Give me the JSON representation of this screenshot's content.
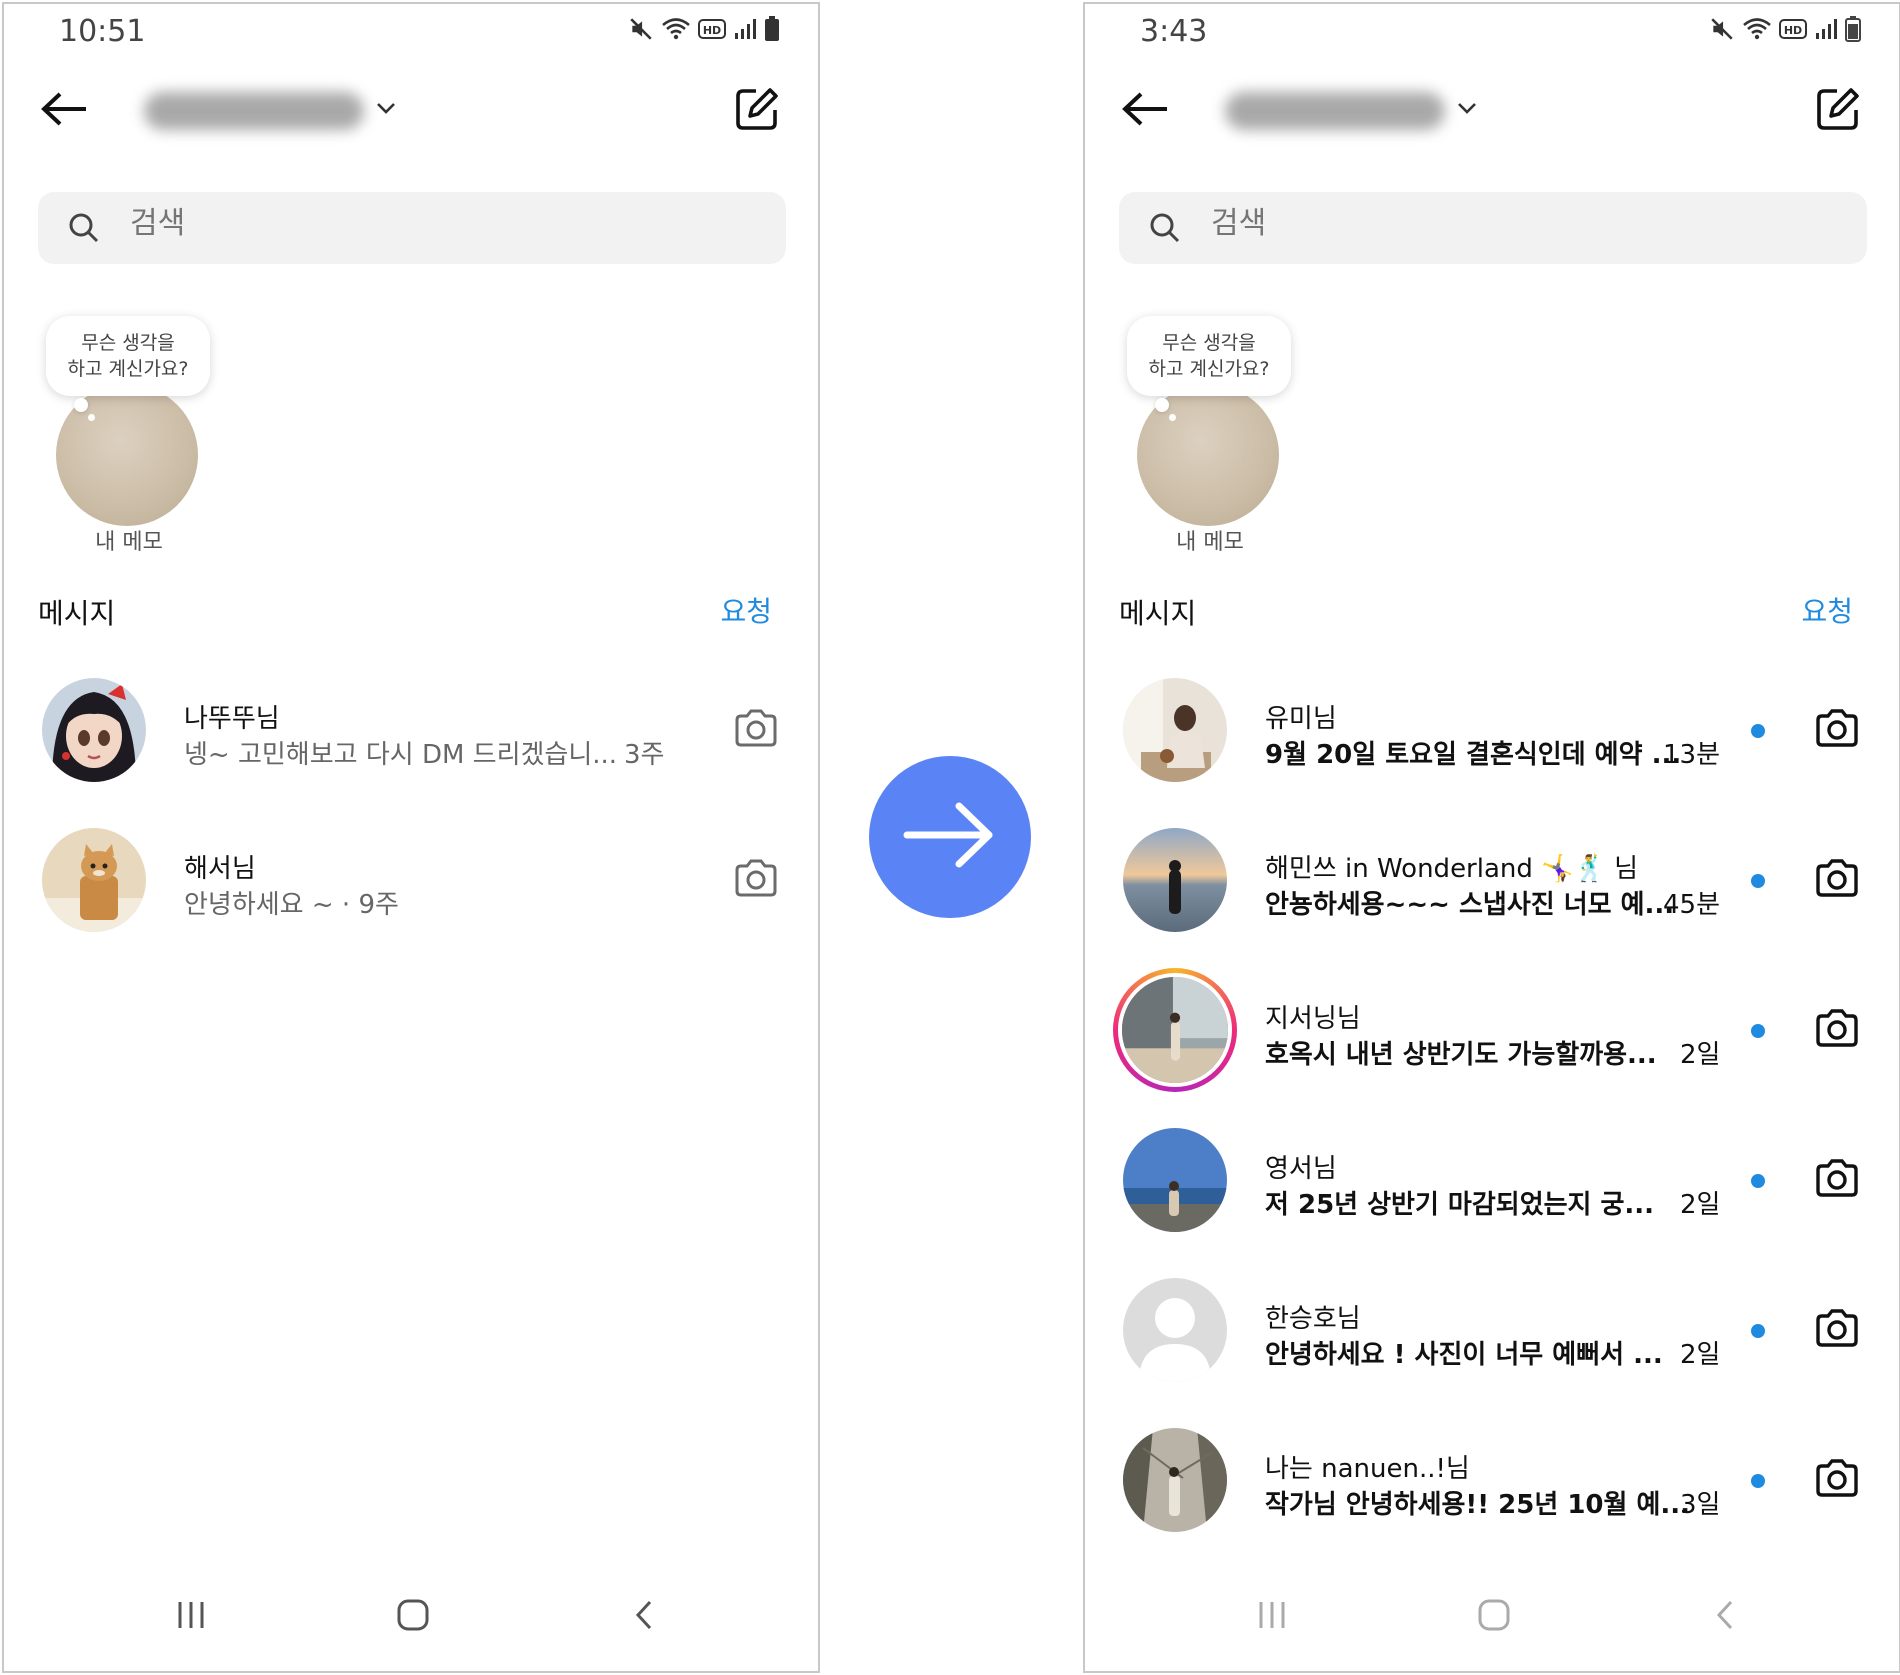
{
  "left": {
    "status_time": "10:51",
    "search_placeholder": "검색",
    "note_text_line1": "무슨 생각을",
    "note_text_line2": "하고 계신가요?",
    "note_label": "내 메모",
    "messages_label": "메시지",
    "requests_label": "요청",
    "conversations": [
      {
        "name": "나뚜뚜님",
        "preview": "넹~ 고민해보고 다시 DM 드리겠습니...",
        "time": "3주",
        "unread": false
      },
      {
        "name": "해서님",
        "preview": "안녕하세요 ~ · 9주",
        "time": "",
        "unread": false
      }
    ]
  },
  "right": {
    "status_time": "3:43",
    "search_placeholder": "검색",
    "note_text_line1": "무슨 생각을",
    "note_text_line2": "하고 계신가요?",
    "note_label": "내 메모",
    "messages_label": "메시지",
    "requests_label": "요청",
    "conversations": [
      {
        "name": "유미님",
        "preview": "9월 20일 토요일 결혼식인데 예약 ...",
        "time": "13분",
        "unread": true
      },
      {
        "name": "해민쓰 in Wonderland 🤸‍♀️🕺 님",
        "preview": "안뇽하세용~~~ 스냅사진 너모 예...",
        "time": "45분",
        "unread": true
      },
      {
        "name": "지서닝님",
        "preview": "호옥시 내년 상반기도 가능할까용...",
        "time": "2일",
        "unread": true
      },
      {
        "name": "영서님",
        "preview": "저 25년 상반기 마감되었는지 궁...",
        "time": "2일",
        "unread": true
      },
      {
        "name": "한승호님",
        "preview": "안녕하세요 ! 사진이 너무 예뻐서 ...",
        "time": "2일",
        "unread": true
      },
      {
        "name": "나는 nanuen..!님",
        "preview": "작가님 안녕하세용!! 25년 10월 예...",
        "time": "3일",
        "unread": true
      }
    ]
  },
  "colors": {
    "accent_blue": "#1f8be0",
    "arrow_circle": "#5a83f5",
    "story_ring": "#ee2a7b"
  },
  "icons": [
    "back-arrow-icon",
    "chevron-down-icon",
    "compose-icon",
    "search-icon",
    "camera-icon",
    "mute-icon",
    "wifi-icon",
    "hd-icon",
    "signal-icon",
    "battery-icon",
    "nav-recent-icon",
    "nav-home-icon",
    "nav-back-icon",
    "arrow-right-icon"
  ]
}
